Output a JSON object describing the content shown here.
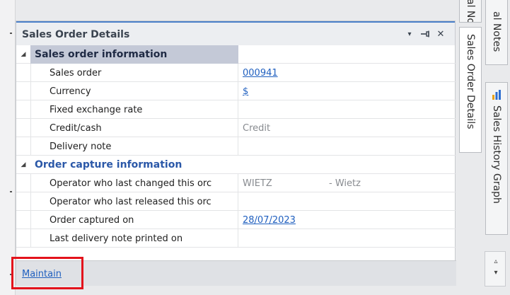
{
  "panel": {
    "title": "Sales Order Details",
    "dropdown_glyph": "▾",
    "pin_glyph": "⊣",
    "close_glyph": "✕"
  },
  "categories": [
    {
      "label": "Sales order information",
      "expander": "◢"
    },
    {
      "label": "Order capture information",
      "expander": "◢"
    }
  ],
  "properties": {
    "sales_order": {
      "label": "Sales order",
      "value": "000941"
    },
    "currency": {
      "label": "Currency",
      "value": "$"
    },
    "fixed_exchange_rate": {
      "label": "Fixed exchange rate",
      "value": ""
    },
    "credit_cash": {
      "label": "Credit/cash",
      "value": "Credit"
    },
    "delivery_note": {
      "label": "Delivery note",
      "value": ""
    },
    "operator_changed": {
      "label": "Operator who last changed this orc",
      "value": "WIETZ",
      "extra": "- Wietz"
    },
    "operator_released": {
      "label": "Operator who last released this orc",
      "value": ""
    },
    "order_captured_on": {
      "label": "Order captured on",
      "value": "28/07/2023"
    },
    "last_delivery_note": {
      "label": "Last delivery note printed on",
      "value": ""
    }
  },
  "footer": {
    "maintain_label": "Maintain"
  },
  "side_tabs": {
    "notes": "al Notes",
    "sales_order_details": "Sales Order Details",
    "sales_history_graph": "Sales History Graph"
  },
  "scroll": {
    "up_glyph": "▵",
    "down_glyph": "▾"
  },
  "colors": {
    "accent_blue": "#4a7fc9",
    "category_band": "#c4c9d7",
    "link": "#1f5fbf",
    "highlight": "#e3131c",
    "chart_icon_bar_1": "#e8a317",
    "chart_icon_bar_2": "#2f6fd0"
  }
}
